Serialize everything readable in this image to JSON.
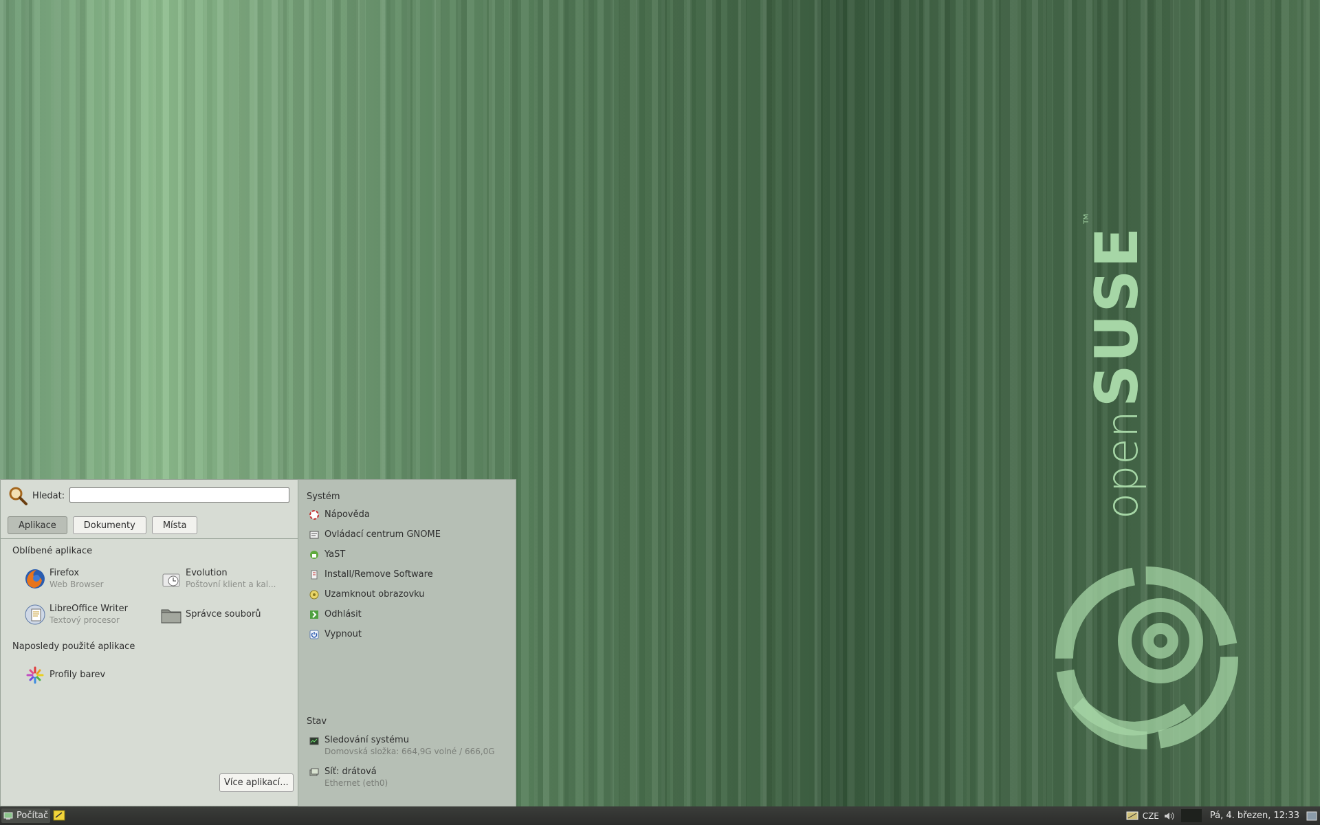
{
  "desktop": {
    "brand": {
      "open": "open",
      "suse": "SUSE",
      "tm": "TM"
    }
  },
  "menu": {
    "search": {
      "label": "Hledat:",
      "value": ""
    },
    "tabs": [
      {
        "label": "Aplikace",
        "active": true
      },
      {
        "label": "Dokumenty",
        "active": false
      },
      {
        "label": "Místa",
        "active": false
      }
    ],
    "favorites_title": "Oblíbené aplikace",
    "favorites": [
      {
        "name": "Firefox",
        "sub": "Web Browser",
        "icon": "firefox-icon"
      },
      {
        "name": "Evolution",
        "sub": "Poštovní klient a kal...",
        "icon": "evolution-icon"
      },
      {
        "name": "LibreOffice Writer",
        "sub": "Textový procesor",
        "icon": "libreoffice-writer-icon"
      },
      {
        "name": "Správce souborů",
        "sub": "",
        "icon": "file-manager-icon"
      }
    ],
    "recent_title": "Naposledy použité aplikace",
    "recent": [
      {
        "name": "Profily barev",
        "icon": "color-profiles-icon"
      }
    ],
    "more_button": "Více aplikací...",
    "system_title": "Systém",
    "system": [
      {
        "label": "Nápověda",
        "icon": "help-icon"
      },
      {
        "label": "Ovládací centrum GNOME",
        "icon": "control-center-icon"
      },
      {
        "label": "YaST",
        "icon": "yast-icon"
      },
      {
        "label": "Install/Remove Software",
        "icon": "install-software-icon"
      },
      {
        "label": "Uzamknout obrazovku",
        "icon": "lock-screen-icon"
      },
      {
        "label": "Odhlásit",
        "icon": "logout-icon"
      },
      {
        "label": "Vypnout",
        "icon": "shutdown-icon"
      }
    ],
    "status_title": "Stav",
    "status": [
      {
        "title": "Sledování systému",
        "detail": "Domovská složka: 664,9G volné / 666,0G",
        "icon": "system-monitor-icon"
      },
      {
        "title": "Síť: drátová",
        "detail": "Ethernet (eth0)",
        "icon": "network-wired-icon"
      }
    ]
  },
  "panel": {
    "start_label": "Počítač",
    "keyboard_layout": "CZE",
    "clock": "Pá,  4. březen, 12:33",
    "colors": {
      "panel": "#2c2d2b",
      "menu_left": "#d7dcd4",
      "menu_right": "#b6bfb5"
    }
  }
}
